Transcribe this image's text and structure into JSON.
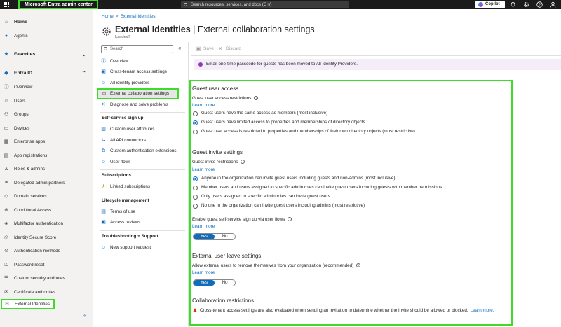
{
  "topbar": {
    "app_title": "Microsoft Entra admin center",
    "search_placeholder": "Search resources, services, and docs (G+/)",
    "copilot_label": "Copilot"
  },
  "leftnav": {
    "home": "Home",
    "agents": "Agents",
    "favorites": "Favorites",
    "entra_id": "Entra ID",
    "items": [
      {
        "label": "Overview",
        "icon": "info-icon"
      },
      {
        "label": "Users",
        "icon": "user-icon"
      },
      {
        "label": "Groups",
        "icon": "group-icon"
      },
      {
        "label": "Devices",
        "icon": "device-icon"
      },
      {
        "label": "Enterprise apps",
        "icon": "apps-icon"
      },
      {
        "label": "App registrations",
        "icon": "app-reg-icon"
      },
      {
        "label": "Roles & admins",
        "icon": "roles-icon"
      },
      {
        "label": "Delegated admin partners",
        "icon": "partners-icon"
      },
      {
        "label": "Domain services",
        "icon": "domain-icon"
      },
      {
        "label": "Conditional Access",
        "icon": "conditional-access-icon"
      },
      {
        "label": "Multifactor authentication",
        "icon": "mfa-icon"
      },
      {
        "label": "Identity Secure Score",
        "icon": "score-icon"
      },
      {
        "label": "Authentication methods",
        "icon": "auth-methods-icon"
      },
      {
        "label": "Password reset",
        "icon": "key-icon"
      },
      {
        "label": "Custom security attributes",
        "icon": "attributes-icon"
      },
      {
        "label": "Certificate authorities",
        "icon": "certificate-icon"
      },
      {
        "label": "External Identities",
        "icon": "external-identities-icon"
      }
    ]
  },
  "blade": {
    "breadcrumb": [
      "Home",
      "External Identities"
    ],
    "title_bold": "External Identities",
    "title_rest": " | External collaboration settings",
    "subtitle": "lcradev7",
    "search_placeholder": "Search",
    "nav": [
      {
        "label": "Overview"
      },
      {
        "label": "Cross-tenant access settings"
      },
      {
        "label": "All identity providers"
      },
      {
        "label": "External collaboration settings"
      },
      {
        "label": "Diagnose and solve problems"
      }
    ],
    "section_selfservice": "Self-service sign up",
    "selfservice": [
      {
        "label": "Custom user attributes"
      },
      {
        "label": "All API connectors"
      },
      {
        "label": "Custom authentication extensions"
      },
      {
        "label": "User flows"
      }
    ],
    "section_subscriptions": "Subscriptions",
    "subscriptions": [
      {
        "label": "Linked subscriptions"
      }
    ],
    "section_lifecycle": "Lifecycle management",
    "lifecycle": [
      {
        "label": "Terms of use"
      },
      {
        "label": "Access reviews"
      }
    ],
    "section_troubleshooting": "Troubleshooting + Support",
    "troubleshooting": [
      {
        "label": "New support request"
      }
    ]
  },
  "content": {
    "save": "Save",
    "discard": "Discard",
    "banner": "Email one-time passcode for guests has been moved to All Identity Providers.",
    "banner_arrow": "→",
    "learn_more": "Learn more",
    "guest_access": {
      "title": "Guest user access",
      "label": "Guest user access restrictions",
      "options": [
        "Guest users have the same access as members (most inclusive)",
        "Guest users have limited access to properties and memberships of directory objects",
        "Guest user access is restricted to properties and memberships of their own directory objects (most restrictive)"
      ],
      "selected": 1
    },
    "guest_invite": {
      "title": "Guest invite settings",
      "label": "Guest invite restrictions",
      "options": [
        "Anyone in the organization can invite guest users including guests and non-admins (most inclusive)",
        "Member users and users assigned to specific admin roles can invite guest users including guests with member permissions",
        "Only users assigned to specific admin roles can invite guest users",
        "No one in the organization can invite guest users including admins (most restrictive)"
      ],
      "selected": 0,
      "selfservice_label": "Enable guest self-service sign up via user flows",
      "selfservice_value": "Yes"
    },
    "leave": {
      "title": "External user leave settings",
      "label": "Allow external users to remove themselves from your organization (recommended)",
      "value": "Yes"
    },
    "toggle_yes": "Yes",
    "toggle_no": "No",
    "collab": {
      "title": "Collaboration restrictions",
      "warning": "Cross-tenant access settings are also evaluated when sending an invitation to determine whether the invite should be allowed or blocked.",
      "link": "Learn more."
    }
  }
}
